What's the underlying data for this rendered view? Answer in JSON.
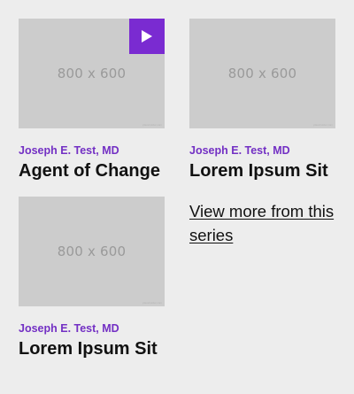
{
  "play_color": "#7a2bd1",
  "author_color": "#7330c4",
  "cards": [
    {
      "thumbnail_label": "800 x 600",
      "has_play_button": true,
      "play_icon": "play-icon",
      "author": "Joseph E. Test, MD",
      "title": "Agent of Change"
    },
    {
      "thumbnail_label": "800 x 600",
      "has_play_button": false,
      "author": "Joseph E. Test, MD",
      "title": "Lorem Ipsum Sit"
    },
    {
      "thumbnail_label": "800 x 600",
      "has_play_button": false,
      "author": "Joseph E. Test, MD",
      "title": "Lorem Ipsum Sit"
    }
  ],
  "view_more_link": "View more from this series"
}
